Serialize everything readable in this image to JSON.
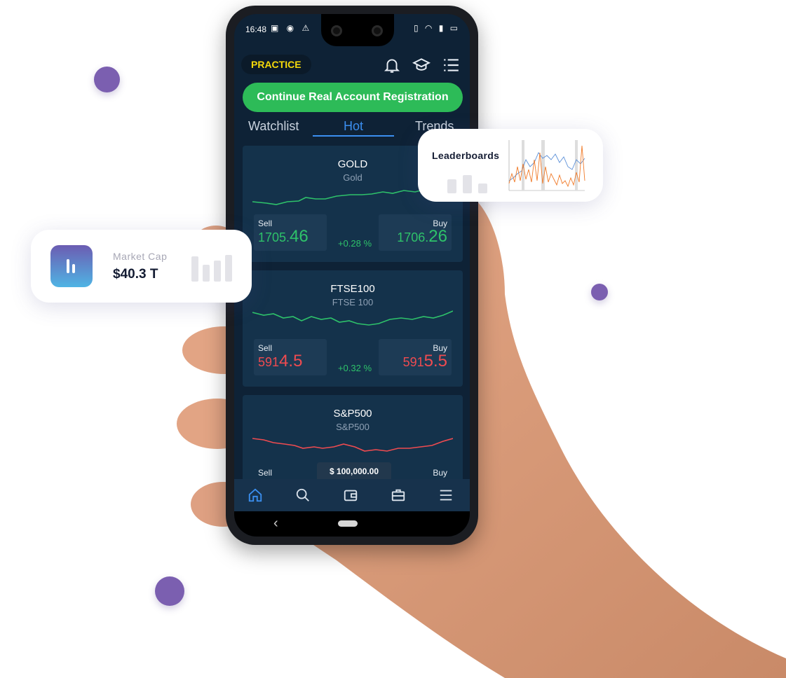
{
  "colors": {
    "accent": "#3b8ff0",
    "cta": "#2dbb58",
    "practice": "#f5d90a",
    "up": "#2ec26a",
    "down": "#ef4b50",
    "dot": "#7b5fb0"
  },
  "status_bar": {
    "time": "16:48"
  },
  "header": {
    "mode_badge": "PRACTICE",
    "icons": [
      "bell-icon",
      "graduation-cap-icon",
      "list-icon"
    ]
  },
  "cta": {
    "label": "Continue Real Account Registration"
  },
  "tabs": [
    {
      "label": "Watchlist"
    },
    {
      "label": "Hot",
      "active": true
    },
    {
      "label": "Trends"
    }
  ],
  "instruments": [
    {
      "name": "GOLD",
      "subtitle": "Gold",
      "trend": "up",
      "sell_label": "Sell",
      "sell_small": "1705.",
      "sell_big": "46",
      "change": "+0.28 %",
      "buy_label": "Buy",
      "buy_small": "1706.",
      "buy_big": "26"
    },
    {
      "name": "FTSE100",
      "subtitle": "FTSE 100",
      "trend": "down",
      "sell_label": "Sell",
      "sell_small": "591",
      "sell_big": "4.5",
      "change": "+0.32 %",
      "buy_label": "Buy",
      "buy_small": "591",
      "buy_big": "5.5"
    },
    {
      "name": "S&P500",
      "subtitle": "S&P500",
      "trend": "down",
      "sell_label": "Sell",
      "buy_label": "Buy"
    }
  ],
  "balance": "$ 100,000.00",
  "bottom_nav": [
    "home-icon",
    "search-icon",
    "wallet-icon",
    "briefcase-icon",
    "menu-icon"
  ],
  "market_cap_card": {
    "label": "Market Cap",
    "value": "$40.3 T"
  },
  "leaderboards_card": {
    "title": "Leaderboards"
  }
}
